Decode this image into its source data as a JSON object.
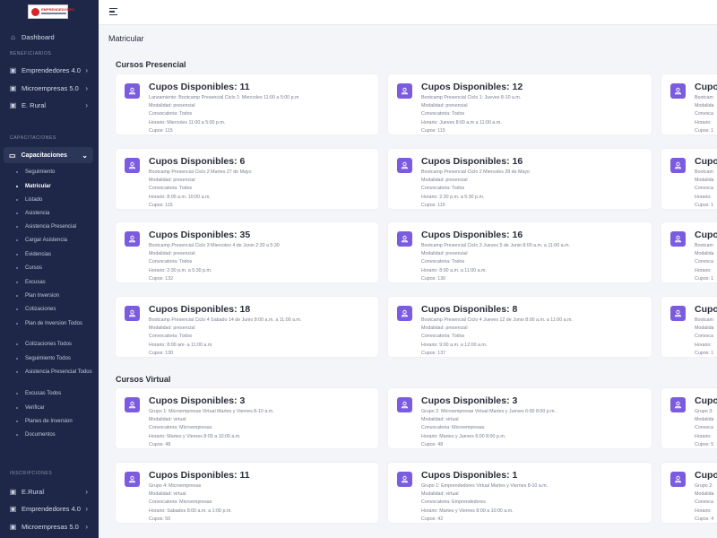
{
  "sidebar": {
    "logo_text": "EMPRENDEDORES",
    "dashboard": "Dashboard",
    "sections": {
      "beneficiarios": "BENEFICIARIOS",
      "capacitaciones": "CAPACITACIONES",
      "inscripciones": "INSCRIPCIONES"
    },
    "benef_items": [
      "Emprendedores 4.0",
      "Microempresas 5.0",
      "E. Rural"
    ],
    "capacitaciones_group": "Capacitaciones",
    "sub_items": [
      "Seguimiento",
      "Matricular",
      "Listado",
      "Asistencia",
      "Asistencia Presencial",
      "Cargar Asistencia",
      "Evidencias",
      "Cursos",
      "Excusas",
      "Plan Inversion",
      "Cotizaciones",
      "Plan de Inversion Todos",
      "Cotizaciones Todos",
      "Seguimiento Todos",
      "Asistencia Presencial Todos",
      "Excusas Todos",
      "Verificar",
      "Planes de Inversion",
      "Documentos"
    ],
    "insc_items": [
      "E.Rural",
      "Emprendedores 4.0",
      "Microempresas 5.0"
    ]
  },
  "page_title": "Matricular",
  "sections": {
    "presencial": "Cursos Presencial",
    "virtual": "Cursos Virtual"
  },
  "cards": [
    {
      "title": "Cupos Disponibles: 11",
      "l1": "Lanzamiento: Bootcamp Presencial Ciclo 1: Miercoles 11:00 a 5:00 p.m",
      "l2": "Modalidad: presencial",
      "l3": "Convocatoria: Todos",
      "l4": "Horario: Miercoles 11:00 a 5:00 p.m.",
      "l5": "Cupos: 115"
    },
    {
      "title": "Cupos Disponibles: 12",
      "l1": "Bootcamp Presencial Ciclo 1: Jueves 8-10 a.m.",
      "l2": "Modalidad: presencial",
      "l3": "Convocatoria: Todos",
      "l4": "Horario: Jueves 8:00 a.m a 11:00 a.m.",
      "l5": "Cupos: 115"
    },
    {
      "title": "Cupos",
      "l1": "Bootcam",
      "l2": "Modalida",
      "l3": "Convoca",
      "l4": "Horario:",
      "l5": "Cupos: 1"
    },
    {
      "title": "Cupos Disponibles: 6",
      "l1": "Bootcamp Presencial Ciclo 2 Martes 27 de Mayo",
      "l2": "Modalidad: presencial",
      "l3": "Convocatoria: Todos",
      "l4": "Horario: 8:00 a.m. 10:00 a.m.",
      "l5": "Cupos: 115"
    },
    {
      "title": "Cupos Disponibles: 16",
      "l1": "Bootcamp Presencial Ciclo 2 Miercoles 28 de Mayo",
      "l2": "Modalidad: presencial",
      "l3": "Convocatoria: Todos",
      "l4": "Horario: 2:30 p.m. a 5:30 p.m.",
      "l5": "Cupos: 115"
    },
    {
      "title": "Cupos",
      "l1": "Bootcam",
      "l2": "Modalida",
      "l3": "Convoca",
      "l4": "Horario:",
      "l5": "Cupos: 1"
    },
    {
      "title": "Cupos Disponibles: 35",
      "l1": "Bootcamp Presencial Ciclo 3 Miercoles 4 de Junio 2:30 a 5:30",
      "l2": "Modalidad: presencial",
      "l3": "Convocatoria: Todos",
      "l4": "Horario: 2:30 p.m. a 5:30 p.m.",
      "l5": "Cupos: 132"
    },
    {
      "title": "Cupos Disponibles: 16",
      "l1": "Bootcamp Presencial Ciclo 3 Jueves 5 de Junio 8:00 a.m. a 11:00 a.m.",
      "l2": "Modalidad: presencial",
      "l3": "Convocatoria: Todos",
      "l4": "Horario: 8:00 a.m. a 11:00 a.m.",
      "l5": "Cupos: 130"
    },
    {
      "title": "Cupos",
      "l1": "Bootcam",
      "l2": "Modalida",
      "l3": "Convoca",
      "l4": "Horario:",
      "l5": "Cupos: 1"
    },
    {
      "title": "Cupos Disponibles: 18",
      "l1": "Bootcamp Presencial Ciclo 4 Sabado 14 de Junio 8:00 a.m. a 11:00 a.m.",
      "l2": "Modalidad: presencial",
      "l3": "Convocatoria: Todos",
      "l4": "Horario: 8:00 am- a 11:00 a.m.",
      "l5": "Cupos: 130"
    },
    {
      "title": "Cupos Disponibles: 8",
      "l1": "Bootcamp Presencial Ciclo 4 Jueves 12 de Junio 8:00 a.m. a 11:00 a.m.",
      "l2": "Modalidad: presencial",
      "l3": "Convocatoria: Todos",
      "l4": "Horario: 9:00 a.m. a 12:00 a.m.",
      "l5": "Cupos: 137"
    },
    {
      "title": "Cupos",
      "l1": "Bootcam",
      "l2": "Modalida",
      "l3": "Convoca",
      "l4": "Horario:",
      "l5": "Cupos: 1"
    },
    {
      "title": "Cupos Disponibles: 3",
      "l1": "Grupo 1: Microempresas Virtual Martes y Viernes 8-10 a.m.",
      "l2": "Modalidad: virtual",
      "l3": "Convocatoria: Microempresas",
      "l4": "Horario: Martes y Viernes 8:00 a 10:00 a.m.",
      "l5": "Cupos: 48"
    },
    {
      "title": "Cupos Disponibles: 3",
      "l1": "Grupo 2: Microempresas Virtual Martes y Jueves 6:00 8:00 p.m.",
      "l2": "Modalidad: virtual",
      "l3": "Convocatoria: Microempresas",
      "l4": "Horario: Martes y Jueves 6:00 8:00 p.m.",
      "l5": "Cupos: 48"
    },
    {
      "title": "Cupos",
      "l1": "Grupo 3:",
      "l2": "Modalida",
      "l3": "Convoca",
      "l4": "Horario:",
      "l5": "Cupos: 5"
    },
    {
      "title": "Cupos Disponibles: 11",
      "l1": "Grupo 4: Microempresas",
      "l2": "Modalidad: virtual",
      "l3": "Convocatoria: Microempresas",
      "l4": "Horario: Sabados 8:00 a.m. a 1:00 p.m.",
      "l5": "Cupos: 56"
    },
    {
      "title": "Cupos Disponibles: 1",
      "l1": "Grupo 1: Emprendedores Virtual Martes y Viernes 8-10 a.m.",
      "l2": "Modalidad: virtual",
      "l3": "Convocatoria: Emprendedores",
      "l4": "Horario: Martes y Viernes 8:00 a 10:00 a.m.",
      "l5": "Cupos: 42"
    },
    {
      "title": "Cupos",
      "l1": "Grupo 2:",
      "l2": "Modalida",
      "l3": "Convoca",
      "l4": "Horario:",
      "l5": "Cupos: 4"
    }
  ]
}
